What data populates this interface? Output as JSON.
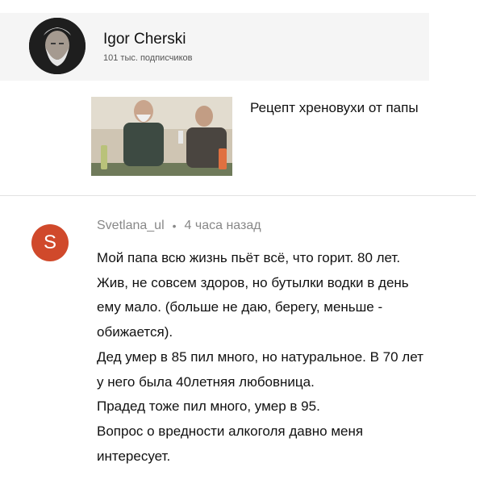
{
  "channel": {
    "name": "Igor Cherski",
    "subscribers": "101 тыс. подписчиков",
    "avatar_icon": "bearded-man-portrait"
  },
  "video": {
    "title": "Рецепт хреновухи от папы",
    "thumbnail_icon": "two-men-drinking-thumbnail"
  },
  "comment": {
    "avatar_letter": "S",
    "avatar_color": "#d0492b",
    "author": "Svetlana_ul",
    "separator": "•",
    "time": "4 часа назад",
    "lines": [
      "Мой папа всю жизнь пьёт всё, что горит. 80 лет.",
      "Жив, не совсем здоров, но бутылки водки в день",
      "ему мало. (больше не даю, берегу, меньше -",
      "обижается).",
      "Дед умер в 85 пил много, но натуральное. В 70 лет",
      "у него была 40летняя любовница.",
      "Прадед тоже пил много, умер в 95.",
      "Вопрос о вредности алкоголя давно меня",
      "интересует."
    ]
  }
}
